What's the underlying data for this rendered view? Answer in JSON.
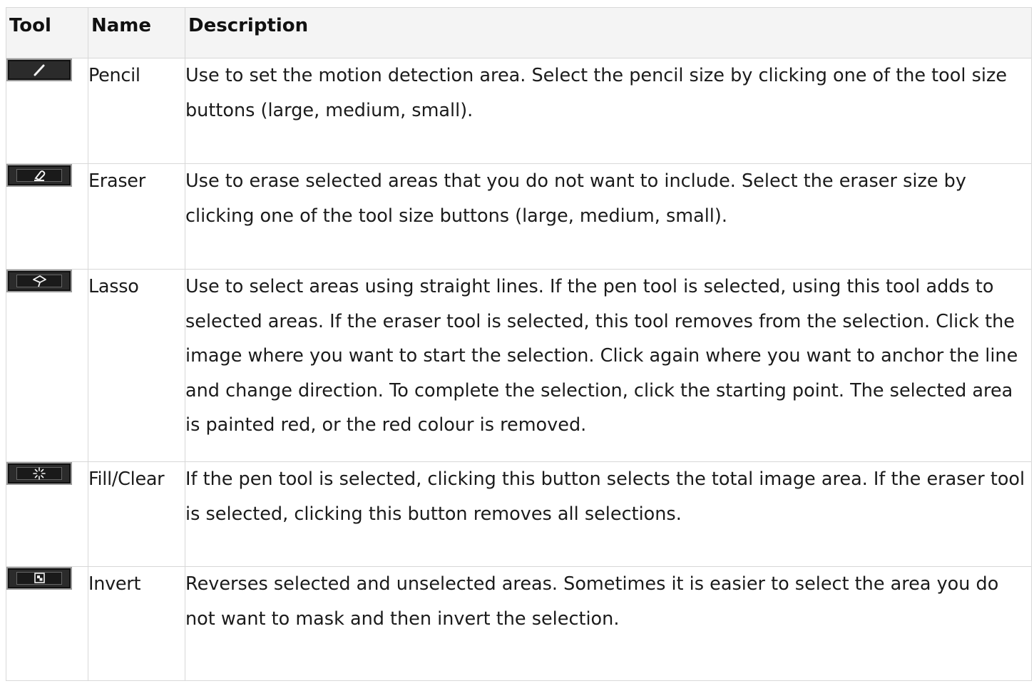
{
  "table": {
    "headers": {
      "tool": "Tool",
      "name": "Name",
      "description": "Description"
    },
    "rows": [
      {
        "icon": "pencil-icon",
        "name": "Pencil",
        "description": "Use to set the motion detection area. Select the pencil size by clicking one of the tool size buttons (large, medium, small)."
      },
      {
        "icon": "eraser-icon",
        "name": "Eraser",
        "description": "Use to erase selected areas that you do not want to include. Select the eraser size by clicking one of the tool size buttons (large, medium, small)."
      },
      {
        "icon": "lasso-icon",
        "name": "Lasso",
        "description": "Use to select areas using straight lines. If the pen tool is selected, using this tool adds to selected areas. If the eraser tool is selected, this tool removes from the selection. Click the image where you want to start the selection. Click again where you want to anchor the line and change direction. To complete the selection, click the starting point. The selected area is painted red, or the red colour is removed."
      },
      {
        "icon": "fill-clear-icon",
        "name": "Fill/Clear",
        "description": "If the pen tool is selected, clicking this button selects the total image area. If the eraser tool is selected, clicking this button removes all selections."
      },
      {
        "icon": "invert-icon",
        "name": "Invert",
        "description": "Reverses selected and unselected areas. Sometimes it is easier to select the area you do not want to mask and then invert the selection."
      }
    ]
  },
  "colors": {
    "header_bg": "#f4f4f4",
    "border": "#d8d8d8",
    "heading_link": "#2d5a9a",
    "button_bg": "#2b2b2b"
  }
}
